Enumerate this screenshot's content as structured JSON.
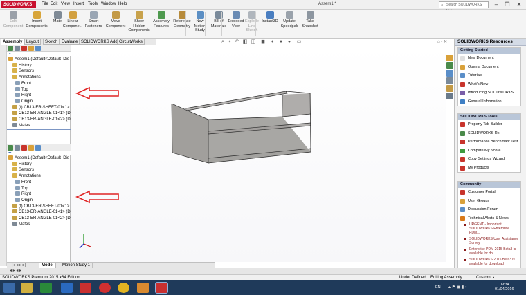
{
  "app": {
    "brand": "SOLIDWORKS",
    "document_title": "Assem1 *",
    "menus": [
      "File",
      "Edit",
      "View",
      "Insert",
      "Tools",
      "Window",
      "Help"
    ],
    "search_placeholder": "Search SOLIDWORKS Help"
  },
  "commands": [
    {
      "label": "Edit\nComponent",
      "enabled": false,
      "icon": "edit-component-icon",
      "color": "#9aa0a8"
    },
    {
      "label": "Insert\nComponents",
      "enabled": true,
      "icon": "insert-components-icon",
      "color": "#d8a53a"
    },
    {
      "label": "Mate",
      "enabled": true,
      "icon": "mate-icon",
      "color": "#7f8a96"
    },
    {
      "label": "Linear\nCompone...",
      "enabled": true,
      "icon": "linear-pattern-icon",
      "color": "#d2a040"
    },
    {
      "label": "Smart\nFasteners",
      "enabled": true,
      "icon": "smart-fasteners-icon",
      "color": "#9aa6b4"
    },
    {
      "label": "Move\nComponent",
      "enabled": true,
      "icon": "move-component-icon",
      "color": "#c39a46"
    },
    {
      "label": "Show\nHidden\nComponents",
      "enabled": true,
      "icon": "show-hidden-icon",
      "color": "#c8a24c"
    },
    {
      "label": "Assembly\nFeatures",
      "enabled": true,
      "icon": "assembly-features-icon",
      "color": "#4f9a4f"
    },
    {
      "label": "Reference\nGeometry",
      "enabled": true,
      "icon": "reference-geometry-icon",
      "color": "#b78b3b"
    },
    {
      "label": "New\nMotion\nStudy",
      "enabled": true,
      "icon": "motion-study-icon",
      "color": "#5c8fc4"
    },
    {
      "label": "Bill of\nMaterials",
      "enabled": true,
      "icon": "bom-icon",
      "color": "#7a8a9a"
    },
    {
      "label": "Exploded\nView",
      "enabled": true,
      "icon": "exploded-view-icon",
      "color": "#6a8bb4"
    },
    {
      "label": "Explode\nLine\nSketch",
      "enabled": false,
      "icon": "explode-line-icon",
      "color": "#b0b6bd"
    },
    {
      "label": "Instant3D",
      "enabled": true,
      "icon": "instant3d-icon",
      "color": "#4a7ec0"
    },
    {
      "label": "Update\nSpeedpak",
      "enabled": true,
      "icon": "speedpak-icon",
      "color": "#9aa2ab"
    },
    {
      "label": "Take\nSnapshot",
      "enabled": true,
      "icon": "snapshot-icon",
      "color": "#8d96a0"
    }
  ],
  "cm_tabs": [
    "Assembly",
    "Layout",
    "Sketch",
    "Evaluate",
    "SOLIDWORKS Add-Ins",
    "CircuitWorks"
  ],
  "tree_top": [
    {
      "label": "Assem1  (Default<Default_Dis",
      "icon": "assembly-icon",
      "color": "#d9a13a"
    },
    {
      "label": "History",
      "icon": "folder-icon",
      "color": "#d8b24a"
    },
    {
      "label": "Sensors",
      "icon": "folder-icon",
      "color": "#d8b24a"
    },
    {
      "label": "Annotations",
      "icon": "annotation-icon",
      "color": "#d8b24a"
    },
    {
      "label": "Front",
      "icon": "plane-icon",
      "color": "#8aa0b8"
    },
    {
      "label": "Top",
      "icon": "plane-icon",
      "color": "#8aa0b8"
    },
    {
      "label": "Right",
      "icon": "plane-icon",
      "color": "#8aa0b8"
    },
    {
      "label": "Origin",
      "icon": "origin-icon",
      "color": "#8aa0b8"
    },
    {
      "label": "(f) CB13-ER-SHEET-01<1> (",
      "icon": "part-icon",
      "color": "#c4a147"
    },
    {
      "label": "CB13-ER-ANGLE-01<1> (De",
      "icon": "part-icon",
      "color": "#c4a147"
    },
    {
      "label": "CB13-ER-ANGLE-01<2> (De",
      "icon": "part-icon",
      "color": "#c4a147"
    },
    {
      "label": "Mates",
      "icon": "mates-icon",
      "color": "#7f8a96"
    }
  ],
  "tree_bottom": [
    {
      "label": "Assem1  (Default<Default_Dis",
      "icon": "assembly-icon",
      "color": "#d9a13a"
    },
    {
      "label": "History",
      "icon": "folder-icon",
      "color": "#d8b24a"
    },
    {
      "label": "Sensors",
      "icon": "folder-icon",
      "color": "#d8b24a"
    },
    {
      "label": "Annotations",
      "icon": "annotation-icon",
      "color": "#d8b24a"
    },
    {
      "label": "Front",
      "icon": "plane-icon",
      "color": "#8aa0b8"
    },
    {
      "label": "Top",
      "icon": "plane-icon",
      "color": "#8aa0b8"
    },
    {
      "label": "Right",
      "icon": "plane-icon",
      "color": "#8aa0b8"
    },
    {
      "label": "Origin",
      "icon": "origin-icon",
      "color": "#8aa0b8"
    },
    {
      "label": "(f) CB13-ER-SHEET-01<1> (",
      "icon": "part-icon",
      "color": "#c4a147"
    },
    {
      "label": "CB13-ER-ANGLE-01<1> (De",
      "icon": "part-icon",
      "color": "#c4a147"
    },
    {
      "label": "CB13-ER-ANGLE-01<2> (De",
      "icon": "part-icon",
      "color": "#c4a147"
    },
    {
      "label": "Mates",
      "icon": "mates-icon",
      "color": "#7f8a96"
    }
  ],
  "bottom_tabs": [
    "Model",
    "Motion Study 1"
  ],
  "resources": {
    "title": "SOLIDWORKS Resources",
    "sections": [
      {
        "title": "Getting Started",
        "items": [
          {
            "label": "New Document",
            "icon": "new-document-icon",
            "color": "#e0e0e0"
          },
          {
            "label": "Open a Document",
            "icon": "open-document-icon",
            "color": "#d9a13a"
          },
          {
            "label": "Tutorials",
            "icon": "tutorials-icon",
            "color": "#5a8ec8"
          },
          {
            "label": "What's New",
            "icon": "whats-new-icon",
            "color": "#c8342c"
          },
          {
            "label": "Introducing SOLIDWORKS",
            "icon": "intro-icon",
            "color": "#7a5ea8"
          },
          {
            "label": "General Information",
            "icon": "info-icon",
            "color": "#3f7fc4"
          }
        ]
      },
      {
        "title": "SOLIDWORKS Tools",
        "items": [
          {
            "label": "Property Tab Builder",
            "icon": "property-tab-icon",
            "color": "#c8342c"
          },
          {
            "label": "SOLIDWORKS Rx",
            "icon": "rx-icon",
            "color": "#4a8a4a"
          },
          {
            "label": "Performance Benchmark Test",
            "icon": "benchmark-icon",
            "color": "#c8342c"
          },
          {
            "label": "Compare My Score",
            "icon": "compare-icon",
            "color": "#3f9a3f"
          },
          {
            "label": "Copy Settings Wizard",
            "icon": "copy-settings-icon",
            "color": "#c8342c"
          },
          {
            "label": "My Products",
            "icon": "products-icon",
            "color": "#c8342c"
          }
        ]
      },
      {
        "title": "Community",
        "items": [
          {
            "label": "Customer Portal",
            "icon": "portal-icon",
            "color": "#c8342c"
          },
          {
            "label": "User Groups",
            "icon": "user-groups-icon",
            "color": "#d9a13a"
          },
          {
            "label": "Discussion Forum",
            "icon": "forum-icon",
            "color": "#5a8ec8"
          },
          {
            "label": "Technical Alerts & News",
            "icon": "alerts-icon",
            "color": "#d97a1a"
          }
        ],
        "news": [
          "URGENT - Important SOLIDWORKS Enterprise PDM...",
          "SOLIDWORKS User Assistance Survey",
          "Enterprise PDM 2015 Beta3 is available for do...",
          "SOLIDWORKS 2015 Beta3 is available for download"
        ]
      }
    ]
  },
  "status": {
    "left": "SOLIDWORKS Premium 2015 x64 Edition",
    "state": "Under Defined",
    "mode": "Editing Assembly",
    "units": "Custom"
  },
  "taskbar": {
    "language": "EN",
    "time": "09:34",
    "date": "01/04/2016"
  },
  "colors": {
    "arrow": "#e02424",
    "model_face": "#a19f9c",
    "model_edge": "#2a2a2a"
  }
}
